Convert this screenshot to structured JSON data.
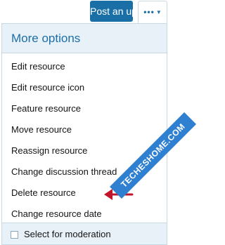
{
  "header": {
    "post_button_label": "Post an update",
    "more_button_icon": "ellipsis-icon",
    "more_button_dots": "•••",
    "more_button_caret": "▼"
  },
  "menu": {
    "title": "More options",
    "items": [
      {
        "label": "Edit resource"
      },
      {
        "label": "Edit resource icon"
      },
      {
        "label": "Feature resource"
      },
      {
        "label": "Move resource"
      },
      {
        "label": "Reassign resource"
      },
      {
        "label": "Change discussion thread"
      },
      {
        "label": "Delete resource"
      },
      {
        "label": "Change resource date"
      }
    ],
    "footer": {
      "checkbox_label": "Select for moderation",
      "checked": false
    }
  },
  "watermark": {
    "text": "TECHESHOME.COM"
  },
  "colors": {
    "accent": "#1a6fa6",
    "header_bg": "#e9f1f8",
    "border": "#c8d9e6",
    "arrow": "#c0152b",
    "watermark_bg": "#2f80d1"
  }
}
